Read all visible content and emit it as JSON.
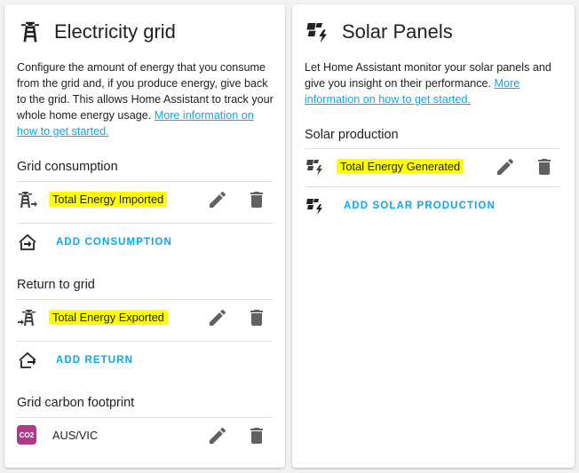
{
  "grid": {
    "title": "Electricity grid",
    "description": "Configure the amount of energy that you consume from the grid and, if you produce energy, give back to the grid. This allows Home Assistant to track your whole home energy usage.",
    "more_info_link": "More information on how to get started.",
    "consumption": {
      "section_title": "Grid consumption",
      "item_label": "Total Energy Imported",
      "add_label": "ADD CONSUMPTION"
    },
    "return": {
      "section_title": "Return to grid",
      "item_label": "Total Energy Exported",
      "add_label": "ADD RETURN"
    },
    "carbon": {
      "section_title": "Grid carbon footprint",
      "badge": "CO2",
      "item_label": "AUS/VIC"
    }
  },
  "solar": {
    "title": "Solar Panels",
    "description": "Let Home Assistant monitor your solar panels and give you insight on their performance.",
    "more_info_link": "More information on how to get started.",
    "section_title": "Solar production",
    "item_label": "Total Energy Generated",
    "add_label": "ADD SOLAR PRODUCTION"
  },
  "colors": {
    "accent": "#03a9f4",
    "highlight": "#ffff00",
    "icon": "#616161",
    "co2_badge": "#b03a8a"
  }
}
